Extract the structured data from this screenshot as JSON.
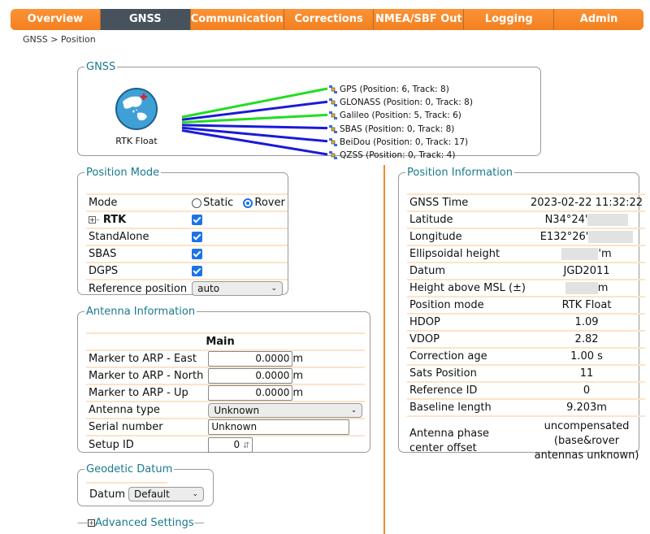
{
  "nav": {
    "tabs": [
      {
        "label": "Overview",
        "active": false
      },
      {
        "label": "GNSS",
        "active": true
      },
      {
        "label": "Communication",
        "active": false
      },
      {
        "label": "Corrections",
        "active": false
      },
      {
        "label": "NMEA/SBF Out",
        "active": false
      },
      {
        "label": "Logging",
        "active": false
      },
      {
        "label": "Admin",
        "active": false
      }
    ]
  },
  "breadcrumb": "GNSS > Position",
  "gnss": {
    "legend": "GNSS",
    "status": "RTK Float",
    "icon": "globe-icon",
    "constellations": [
      {
        "name": "GPS",
        "label": "GPS (Position: 6, Track: 8)",
        "position": 6,
        "track": 8,
        "color": "#22dd22"
      },
      {
        "name": "GLONASS",
        "label": "GLONASS (Position: 0, Track: 8)",
        "position": 0,
        "track": 8,
        "color": "#1a1ad8"
      },
      {
        "name": "Galileo",
        "label": "Galileo (Position: 5, Track: 6)",
        "position": 5,
        "track": 6,
        "color": "#22dd22"
      },
      {
        "name": "SBAS",
        "label": "SBAS (Position: 0, Track: 8)",
        "position": 0,
        "track": 8,
        "color": "#1a1ad8"
      },
      {
        "name": "BeiDou",
        "label": "BeiDou (Position: 0, Track: 17)",
        "position": 0,
        "track": 17,
        "color": "#1a1ad8"
      },
      {
        "name": "QZSS",
        "label": "QZSS (Position: 0, Track: 4)",
        "position": 0,
        "track": 4,
        "color": "#1a1ad8"
      }
    ]
  },
  "position_mode": {
    "legend": "Position Mode",
    "mode_label": "Mode",
    "mode_options": [
      "Static",
      "Rover"
    ],
    "mode_selected": "Rover",
    "rows": [
      {
        "label": "RTK",
        "checked": true
      },
      {
        "label": "StandAlone",
        "checked": true
      },
      {
        "label": "SBAS",
        "checked": true
      },
      {
        "label": "DGPS",
        "checked": true
      }
    ],
    "ref_label": "Reference position",
    "ref_value": "auto"
  },
  "antenna": {
    "legend": "Antenna Information",
    "column": "Main",
    "east_label": "Marker to ARP - East",
    "east_value": "0.0000",
    "north_label": "Marker to ARP - North",
    "north_value": "0.0000",
    "up_label": "Marker to ARP - Up",
    "up_value": "0.0000",
    "unit": "m",
    "type_label": "Antenna type",
    "type_value": "Unknown",
    "serial_label": "Serial number",
    "serial_value": "Unknown",
    "setup_label": "Setup ID",
    "setup_value": "0"
  },
  "datum": {
    "legend": "Geodetic Datum",
    "label": "Datum",
    "value": "Default"
  },
  "advanced": "Advanced Settings",
  "position_info": {
    "legend": "Position Information",
    "gnss_time_label": "GNSS Time",
    "gnss_time": "2023-02-22 11:32:22",
    "lat_label": "Latitude",
    "lat": "N34°24'",
    "lon_label": "Longitude",
    "lon": "E132°26'",
    "ell_label": "Ellipsoidal height",
    "ell_suffix": "'m",
    "datum_label": "Datum",
    "datum": "JGD2011",
    "msl_label": "Height above MSL (±)",
    "msl_suffix": "m",
    "mode_label": "Position mode",
    "mode": "RTK Float",
    "hdop_label": "HDOP",
    "hdop": "1.09",
    "vdop_label": "VDOP",
    "vdop": "2.82",
    "corr_label": "Correction age",
    "corr": "1.00 s",
    "sats_label": "Sats Position",
    "sats": "11",
    "ref_label": "Reference ID",
    "ref": "0",
    "baseline_label": "Baseline length",
    "baseline": "9.203m",
    "apc_label": "Antenna phase center offset",
    "apc": "uncompensated (base&rover antennas unknown)"
  }
}
